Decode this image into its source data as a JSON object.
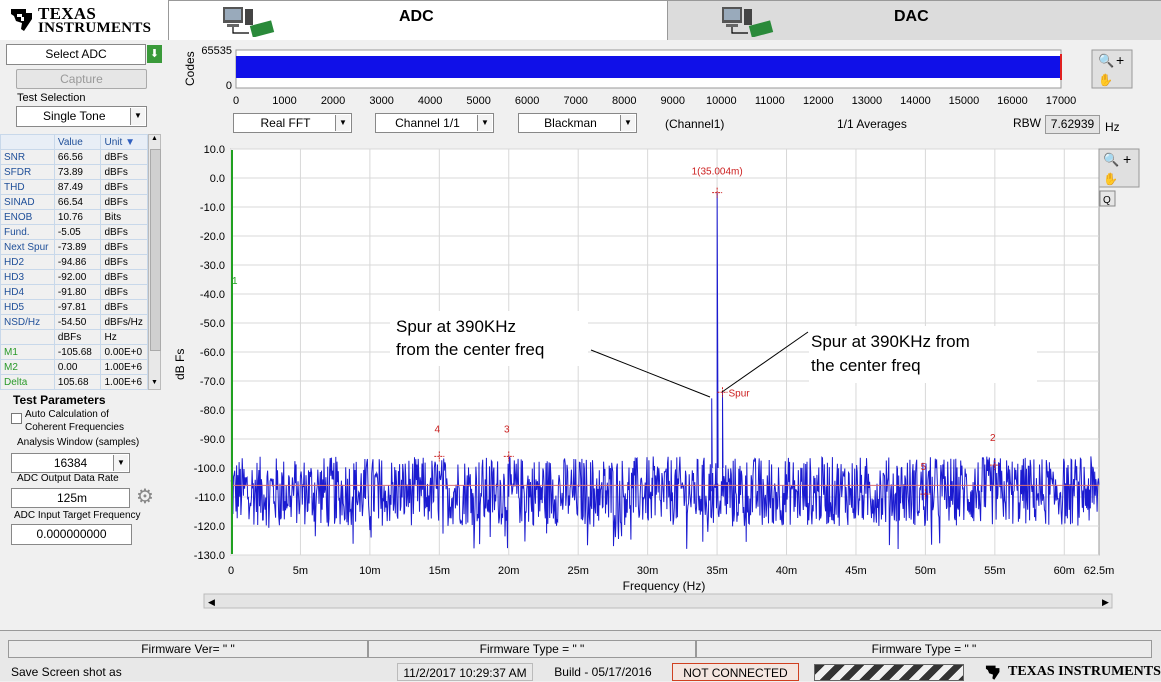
{
  "header": {
    "logo_line1": "Texas",
    "logo_line2": "Instruments",
    "tab_adc": "ADC",
    "tab_dac": "DAC"
  },
  "left": {
    "select_adc": "Select ADC",
    "capture": "Capture",
    "test_selection_label": "Test Selection",
    "test_selection_value": "Single Tone",
    "table_headers": [
      "",
      "Value",
      "Unit"
    ],
    "metrics": [
      {
        "name": "SNR",
        "value": "66.56",
        "unit": "dBFs"
      },
      {
        "name": "SFDR",
        "value": "73.89",
        "unit": "dBFs"
      },
      {
        "name": "THD",
        "value": "87.49",
        "unit": "dBFs"
      },
      {
        "name": "SINAD",
        "value": "66.54",
        "unit": "dBFs"
      },
      {
        "name": "ENOB",
        "value": "10.76",
        "unit": "Bits"
      },
      {
        "name": "Fund.",
        "value": "-5.05",
        "unit": "dBFs"
      },
      {
        "name": "Next Spur",
        "value": "-73.89",
        "unit": "dBFs"
      },
      {
        "name": "HD2",
        "value": "-94.86",
        "unit": "dBFs"
      },
      {
        "name": "HD3",
        "value": "-92.00",
        "unit": "dBFs"
      },
      {
        "name": "HD4",
        "value": "-91.80",
        "unit": "dBFs"
      },
      {
        "name": "HD5",
        "value": "-97.81",
        "unit": "dBFs"
      },
      {
        "name": "NSD/Hz",
        "value": "-54.50",
        "unit": "dBFs/Hz"
      },
      {
        "name": "",
        "value": "dBFs",
        "unit": "Hz"
      },
      {
        "name": "M1",
        "value": "-105.68",
        "unit": "0.00E+0"
      },
      {
        "name": "M2",
        "value": "0.00",
        "unit": "1.00E+6"
      },
      {
        "name": "Delta",
        "value": "105.68",
        "unit": "1.00E+6"
      }
    ],
    "test_params_title": "Test Parameters",
    "auto_calc_line1": "Auto Calculation of",
    "auto_calc_line2": "Coherent Frequencies",
    "analysis_window_label": "Analysis Window (samples)",
    "analysis_window_value": "16384",
    "output_rate_label": "ADC Output Data Rate",
    "output_rate_value": "125m",
    "input_freq_label": "ADC Input Target Frequency",
    "input_freq_value": "0.000000000"
  },
  "top_plot": {
    "ylabel": "Codes",
    "y_ticks": [
      "65535",
      "0"
    ],
    "x_ticks": [
      "0",
      "1000",
      "2000",
      "3000",
      "4000",
      "5000",
      "6000",
      "7000",
      "8000",
      "9000",
      "10000",
      "11000",
      "12000",
      "13000",
      "14000",
      "15000",
      "16000",
      "17000"
    ]
  },
  "controls": {
    "fft_type": "Real FFT",
    "channel": "Channel 1/1",
    "window": "Blackman",
    "channel_label": "(Channel1)",
    "averages": "1/1 Averages",
    "rbw_label": "RBW",
    "rbw_value": "7.62939",
    "rbw_unit": "Hz"
  },
  "chart_data": {
    "type": "line",
    "xlabel": "Frequency (Hz)",
    "ylabel": "dB Fs",
    "x_ticks": [
      "0",
      "5m",
      "10m",
      "15m",
      "20m",
      "25m",
      "30m",
      "35m",
      "40m",
      "45m",
      "50m",
      "55m",
      "60m",
      "62.5m"
    ],
    "y_ticks": [
      "10.0",
      "0.0",
      "-10.0",
      "-20.0",
      "-30.0",
      "-40.0",
      "-50.0",
      "-60.0",
      "-70.0",
      "-80.0",
      "-90.0",
      "-100.0",
      "-110.0",
      "-120.0",
      "-130.0"
    ],
    "xlim": [
      0,
      62.5
    ],
    "ylim": [
      -130,
      10
    ],
    "noise_floor_db": -108,
    "fundamental": {
      "freq_mhz": 35.004,
      "db": -5.05,
      "label": "1(35.004m)"
    },
    "spur": {
      "freq_mhz": 35.39,
      "db": -73.89,
      "label": "Spur"
    },
    "harmonics": [
      {
        "label": "4",
        "freq_mhz": 15.0,
        "db": -96
      },
      {
        "label": "3",
        "freq_mhz": 20.0,
        "db": -96
      },
      {
        "label": "5",
        "freq_mhz": 50.0,
        "db": -109
      },
      {
        "label": "2",
        "freq_mhz": 55.0,
        "db": -99
      }
    ],
    "marker_left_label": "1",
    "annotations": [
      {
        "line1": "Spur at 390KHz",
        "line2": "from the center freq"
      },
      {
        "line1": "Spur at 390KHz from",
        "line2": "the center freq"
      }
    ]
  },
  "footer": {
    "firmware_ver": "Firmware  Ver=  \" \"",
    "firmware_type1": "Firmware Type = \" \"",
    "firmware_type2": "Firmware Type = \" \"",
    "save_label": "Save Screen shot as",
    "datetime": "11/2/2017 10:29:37 AM",
    "build": "Build  - 05/17/2016",
    "status": "NOT CONNECTED",
    "ti_brand": "Texas Instruments"
  },
  "colors": {
    "trace": "#1a1ad0",
    "marker": "#cc2020",
    "status_border": "#d04020"
  }
}
